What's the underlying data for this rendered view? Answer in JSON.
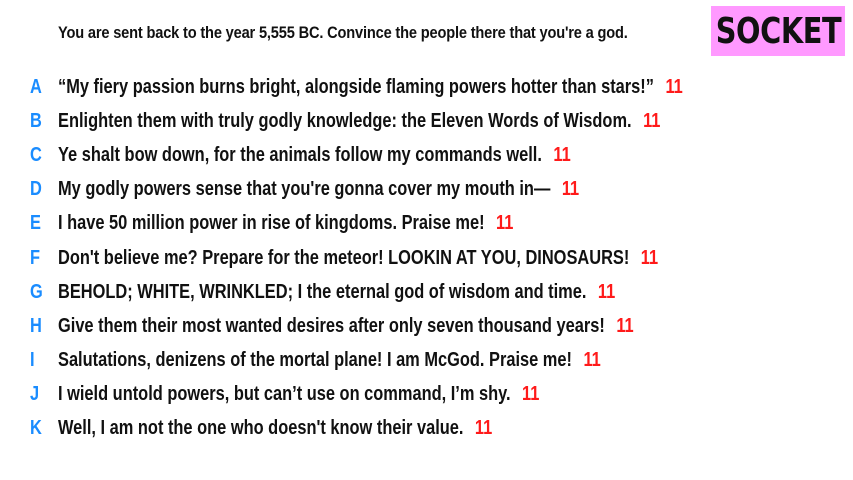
{
  "prompt": "You are sent back to the year 5,555 BC. Convince the people there that you're a god.",
  "badge": "SOCKET",
  "colors": {
    "letter": "#1a8cff",
    "score": "#ff1a1a",
    "badge_bg": "#ff99ff"
  },
  "answers": [
    {
      "letter": "A",
      "text": "“My fiery passion burns bright, alongside flaming powers hotter than stars!”",
      "score": "11"
    },
    {
      "letter": "B",
      "text": "Enlighten them with truly godly knowledge: the Eleven Words of Wisdom.",
      "score": "11"
    },
    {
      "letter": "C",
      "text": "Ye shalt bow down, for the animals follow my commands well.",
      "score": "11"
    },
    {
      "letter": "D",
      "text": "My godly powers sense that you're gonna cover my mouth in—",
      "score": "11"
    },
    {
      "letter": "E",
      "text": "I have 50 million power in rise of kingdoms. Praise me!",
      "score": "11"
    },
    {
      "letter": "F",
      "text": "Don't believe me? Prepare for the meteor! LOOKIN AT YOU, DINOSAURS!",
      "score": "11"
    },
    {
      "letter": "G",
      "text": "BEHOLD; WHITE, WRINKLED; I the eternal god of wisdom and time.",
      "score": "11"
    },
    {
      "letter": "H",
      "text": "Give them their most wanted desires after only seven thousand years!",
      "score": "11"
    },
    {
      "letter": "I",
      "text": "Salutations, denizens of the mortal plane! I am McGod. Praise me!",
      "score": "11"
    },
    {
      "letter": "J",
      "text": "I wield untold powers, but can’t use on command, I’m shy.",
      "score": "11"
    },
    {
      "letter": "K",
      "text": "Well, I am not the one who doesn't know their value.",
      "score": "11"
    }
  ]
}
